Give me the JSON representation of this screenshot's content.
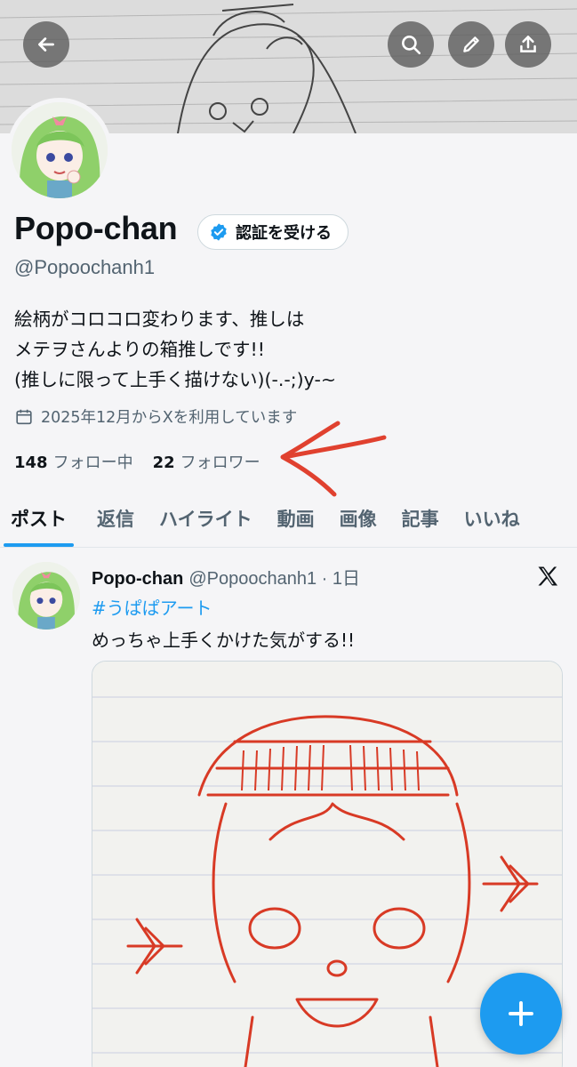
{
  "header": {
    "back_icon": "arrow-left-icon",
    "actions": [
      "search-icon",
      "pen-icon",
      "share-icon"
    ]
  },
  "profile": {
    "name": "Popo-chan",
    "verify_label": "認証を受ける",
    "handle": "@Popoochanh1",
    "bio": [
      "絵柄がコロコロ変わります、推しは",
      "メテヲさんよりの箱推しです!!",
      "(推しに限って上手く描けない)(-.-;)y-~"
    ],
    "joined": "2025年12月からXを利用しています",
    "following_count": "148",
    "following_label": "フォロー中",
    "followers_count": "22",
    "followers_label": "フォロワー"
  },
  "tabs": [
    {
      "label": "ポスト",
      "active": true
    },
    {
      "label": "返信"
    },
    {
      "label": "ハイライト"
    },
    {
      "label": "動画"
    },
    {
      "label": "画像"
    },
    {
      "label": "記事"
    },
    {
      "label": "いいね"
    }
  ],
  "post": {
    "name": "Popo-chan",
    "handle_time": "@Popoochanh1 · 1日",
    "hashtag": "#うぱぱアート",
    "text": "めっちゃ上手くかけた気がする!!"
  },
  "colors": {
    "accent": "#1d9bf0",
    "annotation": "#e0412f",
    "text_secondary": "#536471"
  }
}
